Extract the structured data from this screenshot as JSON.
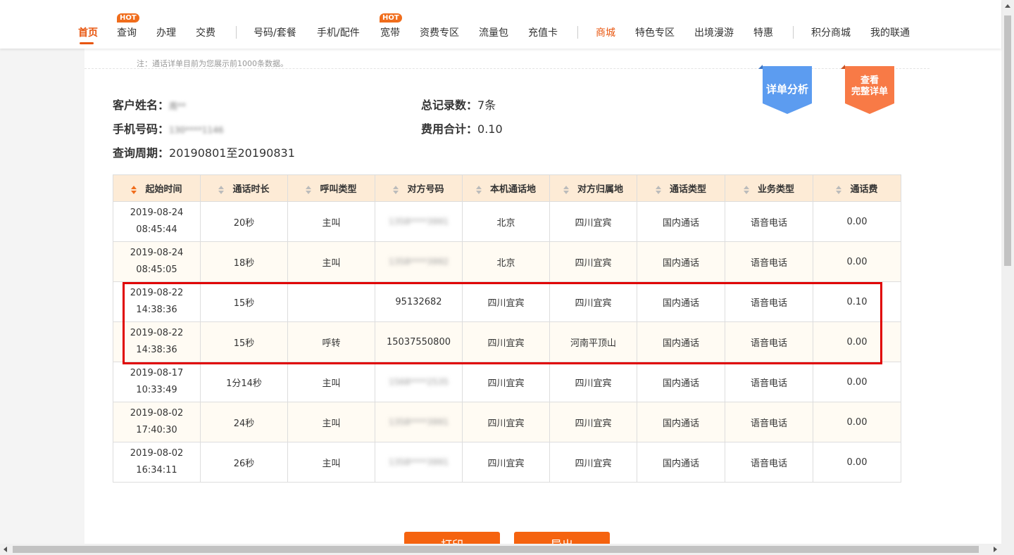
{
  "nav": {
    "items": [
      {
        "label": "首页"
      },
      {
        "label": "查询",
        "badge": "HOT"
      },
      {
        "label": "办理"
      },
      {
        "label": "交费"
      },
      {
        "label": "号码/套餐"
      },
      {
        "label": "手机/配件"
      },
      {
        "label": "宽带",
        "badge": "HOT"
      },
      {
        "label": "资费专区"
      },
      {
        "label": "流量包"
      },
      {
        "label": "充值卡"
      },
      {
        "label": "商城"
      },
      {
        "label": "特色专区"
      },
      {
        "label": "出境漫游"
      },
      {
        "label": "特惠"
      },
      {
        "label": "积分商城"
      },
      {
        "label": "我的联通"
      }
    ],
    "active_color": "#e8560f"
  },
  "note": "注：通话详单目前为您展示前1000条数据。",
  "info": {
    "name_label": "客户姓名：",
    "name_value": "周**",
    "phone_label": "手机号码：",
    "phone_value": "130****1146",
    "period_label": "查询周期：",
    "period_value": "20190801至20190831",
    "total_label": "总记录数：",
    "total_value": "7条",
    "fee_label": "费用合计：",
    "fee_value": "0.10"
  },
  "ribbons": {
    "analysis": "详单分析",
    "full_line1": "查看",
    "full_line2": "完整详单"
  },
  "table": {
    "headers": [
      "起始时间",
      "通话时长",
      "呼叫类型",
      "对方号码",
      "本机通话地",
      "对方归属地",
      "通话类型",
      "业务类型",
      "通话费"
    ],
    "rows": [
      {
        "date": "2019-08-24",
        "time": "08:45:44",
        "duration": "20秒",
        "call_type": "主叫",
        "number": "1358****3991",
        "local": "北京",
        "remote": "四川宜宾",
        "kind": "国内通话",
        "service": "语音电话",
        "fee": "0.00"
      },
      {
        "date": "2019-08-24",
        "time": "08:45:05",
        "duration": "18秒",
        "call_type": "主叫",
        "number": "1358****3992",
        "local": "北京",
        "remote": "四川宜宾",
        "kind": "国内通话",
        "service": "语音电话",
        "fee": "0.00"
      },
      {
        "date": "2019-08-22",
        "time": "14:38:36",
        "duration": "15秒",
        "call_type": "",
        "number": "95132682",
        "local": "四川宜宾",
        "remote": "四川宜宾",
        "kind": "国内通话",
        "service": "语音电话",
        "fee": "0.10"
      },
      {
        "date": "2019-08-22",
        "time": "14:38:36",
        "duration": "15秒",
        "call_type": "呼转",
        "number": "15037550800",
        "local": "四川宜宾",
        "remote": "河南平顶山",
        "kind": "国内通话",
        "service": "语音电话",
        "fee": "0.00"
      },
      {
        "date": "2019-08-17",
        "time": "10:33:49",
        "duration": "1分14秒",
        "call_type": "主叫",
        "number": "1568****2535",
        "local": "四川宜宾",
        "remote": "四川宜宾",
        "kind": "国内通话",
        "service": "语音电话",
        "fee": "0.00"
      },
      {
        "date": "2019-08-02",
        "time": "17:40:30",
        "duration": "24秒",
        "call_type": "主叫",
        "number": "1358****3991",
        "local": "四川宜宾",
        "remote": "四川宜宾",
        "kind": "国内通话",
        "service": "语音电话",
        "fee": "0.00"
      },
      {
        "date": "2019-08-02",
        "time": "16:34:11",
        "duration": "26秒",
        "call_type": "主叫",
        "number": "1358****3991",
        "local": "四川宜宾",
        "remote": "四川宜宾",
        "kind": "国内通话",
        "service": "语音电话",
        "fee": "0.00"
      }
    ]
  },
  "buttons": {
    "left": "打印",
    "right": "导出"
  },
  "colors": {
    "accent": "#f5630f",
    "header_bg": "#fdebd6",
    "highlight": "#e00000",
    "ribbon_blue": "#5c9cf0",
    "ribbon_orange": "#f87a46"
  }
}
